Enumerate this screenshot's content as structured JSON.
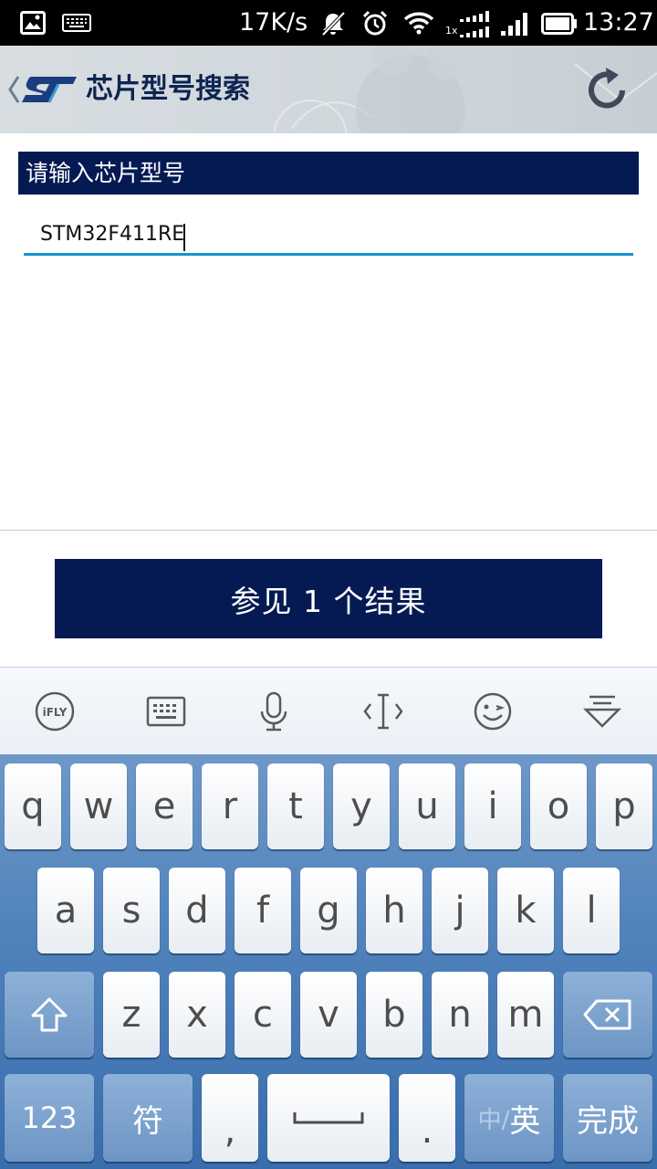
{
  "status_bar": {
    "speed": "17K/s",
    "time": "13:27",
    "signal_label": "1x"
  },
  "header": {
    "title": "芯片型号搜索"
  },
  "search": {
    "label": "请输入芯片型号",
    "value": "STM32F411RE"
  },
  "result_button": {
    "label": "参见 1 个结果"
  },
  "keyboard": {
    "row1": [
      "q",
      "w",
      "e",
      "r",
      "t",
      "y",
      "u",
      "i",
      "o",
      "p"
    ],
    "row2": [
      "a",
      "s",
      "d",
      "f",
      "g",
      "h",
      "j",
      "k",
      "l"
    ],
    "row3": [
      "z",
      "x",
      "c",
      "v",
      "b",
      "n",
      "m"
    ],
    "numbers_key": "123",
    "symbols_key": "符",
    "comma_key": ",",
    "period_key": ".",
    "lang_key_inactive": "中/",
    "lang_key_active": "英",
    "done_key": "完成",
    "colors": {
      "key": "#ffffff",
      "function_key": "#7ba3d0",
      "background": "#4f82bb"
    }
  },
  "colors": {
    "brand_navy": "#051a52",
    "input_underline": "#1593d1"
  }
}
